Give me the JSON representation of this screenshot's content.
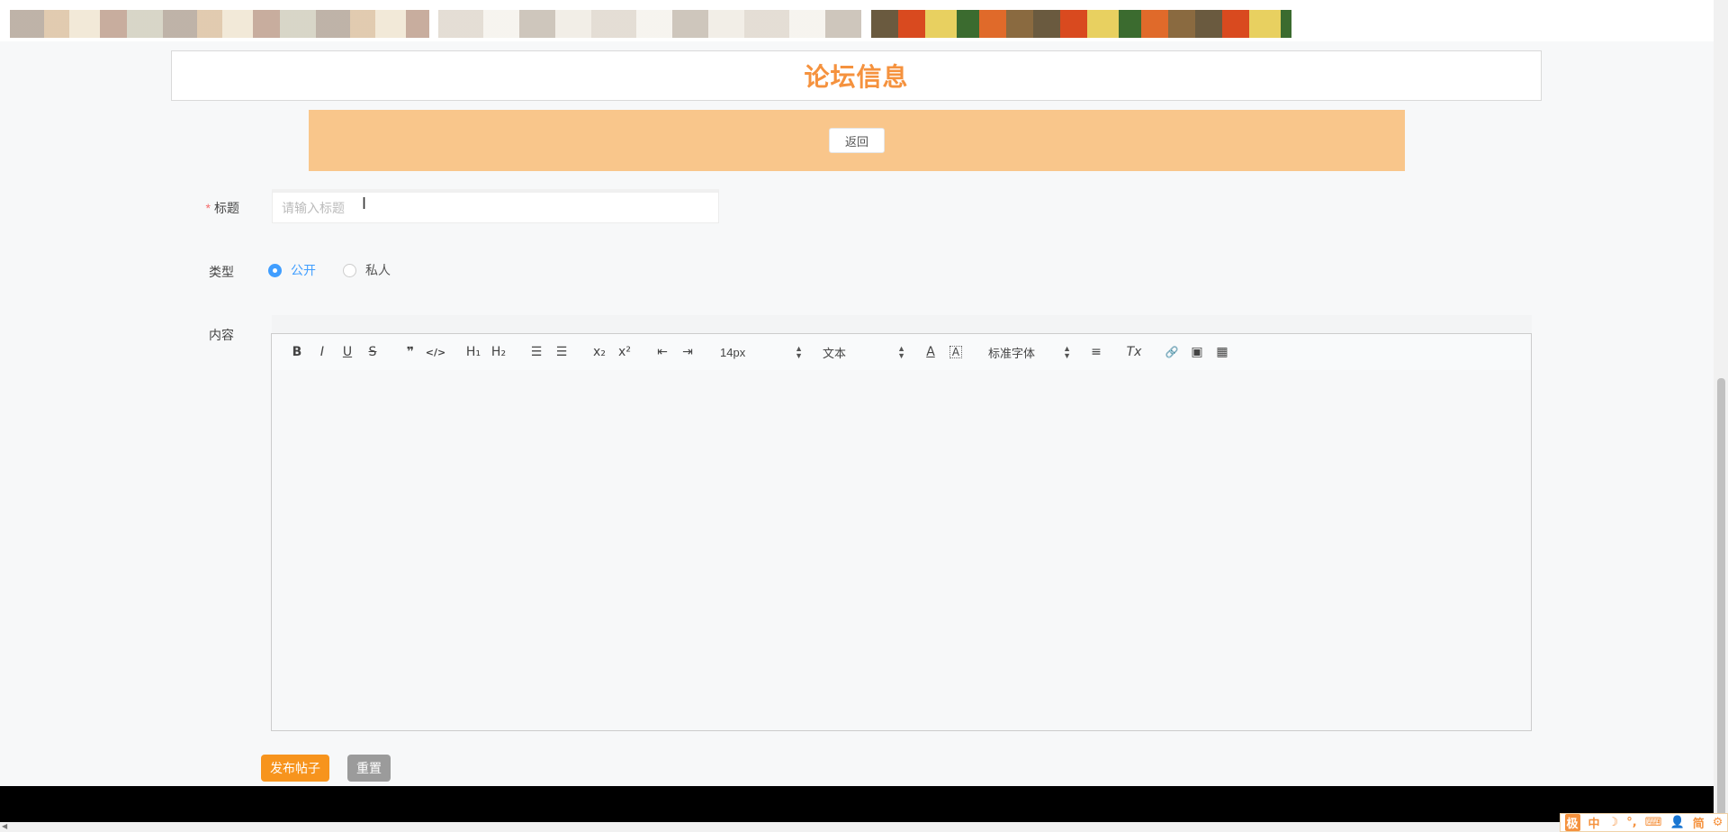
{
  "page": {
    "title": "论坛信息"
  },
  "actions": {
    "back_label": "返回",
    "publish_label": "发布帖子",
    "reset_label": "重置"
  },
  "form": {
    "title_label": "标题",
    "required_mark": "*",
    "title_placeholder": "请输入标题",
    "title_value": "",
    "type_label": "类型",
    "type_options": [
      {
        "label": "公开",
        "checked": true
      },
      {
        "label": "私人",
        "checked": false
      }
    ],
    "content_label": "内容"
  },
  "editor": {
    "toolbar": {
      "bold": "B",
      "italic": "I",
      "underline": "U",
      "strike": "S",
      "blockquote": "❞",
      "code": "</>",
      "h1": "H₁",
      "h2": "H₂",
      "ordered_list": "☰",
      "bullet_list": "☰",
      "subscript": "x₂",
      "superscript": "x²",
      "outdent": "⇤",
      "indent": "⇥",
      "size_value": "14px",
      "header_value": "文本",
      "font_color": "A",
      "background_color": "A",
      "font_value": "标准字体",
      "align": "≡",
      "clean": "Tx",
      "link": "🔗",
      "image": "▣",
      "video": "▦"
    }
  },
  "ime": {
    "items": [
      "极",
      "中",
      "☽",
      "°,",
      "⌨",
      "👤",
      "简",
      "⚙"
    ]
  },
  "colors": {
    "accent": "#f5923e",
    "orange_bar": "#f9c68b",
    "publish": "#f7941d",
    "radio_active": "#409eff"
  }
}
